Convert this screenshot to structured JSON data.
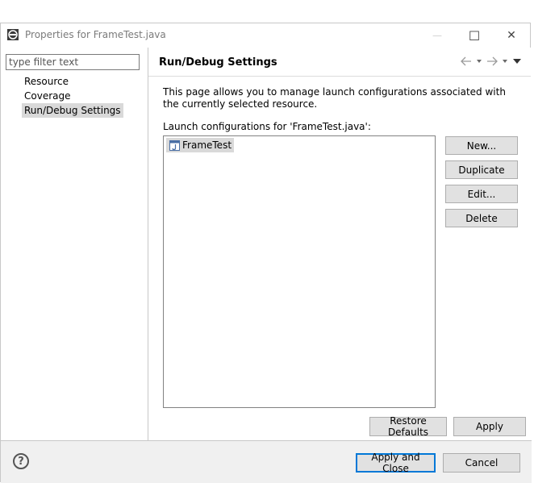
{
  "window": {
    "title": "Properties for FrameTest.java",
    "minimize_glyph": "—",
    "maximize_glyph": "☐",
    "close_glyph": "✕"
  },
  "sidebar": {
    "filter_placeholder": "type filter text",
    "items": [
      {
        "label": "Resource",
        "selected": false
      },
      {
        "label": "Coverage",
        "selected": false
      },
      {
        "label": "Run/Debug Settings",
        "selected": true
      }
    ]
  },
  "page": {
    "title": "Run/Debug Settings",
    "nav_icons": [
      "back-arrow-icon",
      "dropdown-icon",
      "forward-arrow-icon",
      "dropdown-icon",
      "view-menu-icon"
    ],
    "description": "This page allows you to manage launch configurations associated with the currently selected resource.",
    "launch_label": "Launch configurations for 'FrameTest.java':",
    "configurations": [
      {
        "name": "FrameTest",
        "icon": "java-app-icon"
      }
    ],
    "buttons": {
      "new": "New...",
      "duplicate": "Duplicate",
      "edit": "Edit...",
      "delete": "Delete"
    },
    "restore_defaults": "Restore Defaults",
    "apply": "Apply"
  },
  "footer": {
    "help_glyph": "?",
    "apply_and_close": "Apply and Close",
    "cancel": "Cancel"
  },
  "colors": {
    "default_button_border": "#0078d7",
    "selection": "#d9d9d9",
    "footer_bg": "#f0f0f0"
  }
}
